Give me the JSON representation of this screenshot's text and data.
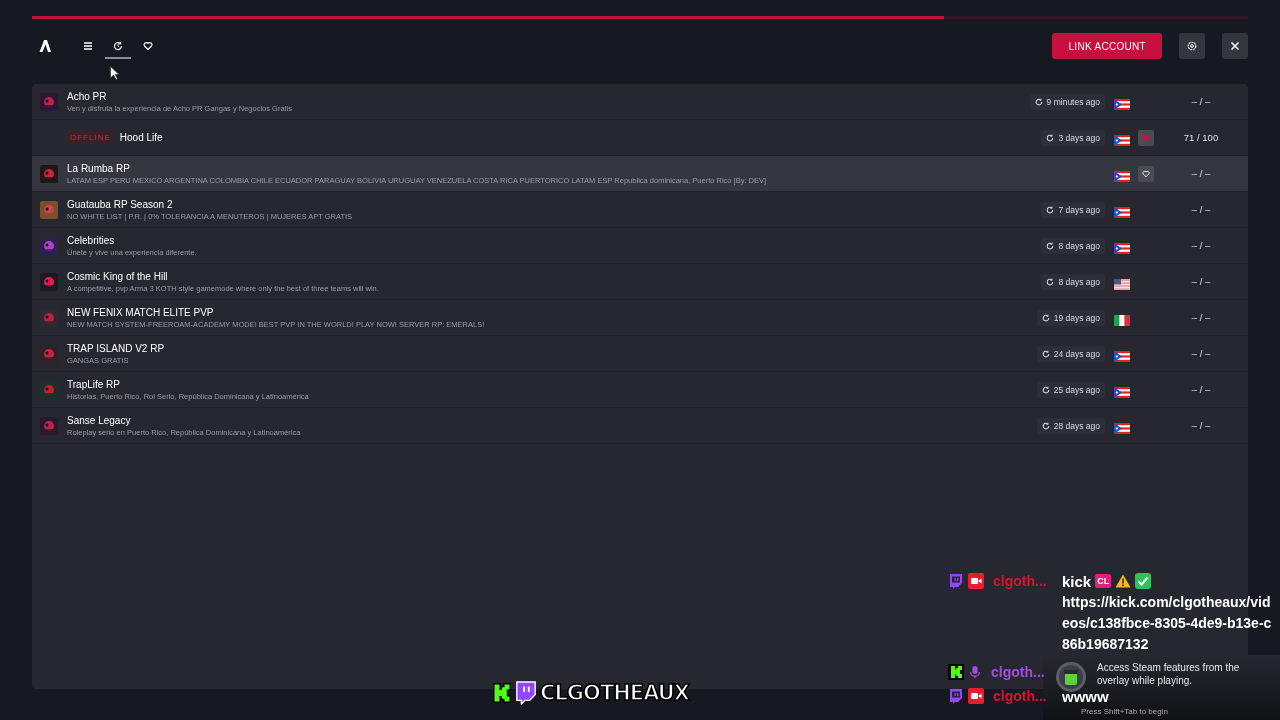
{
  "progress": {
    "level": 0.75
  },
  "nav_tabs": [
    {
      "kind": "menu",
      "selected": false
    },
    {
      "kind": "history",
      "selected": true
    },
    {
      "kind": "favorites",
      "selected": false
    }
  ],
  "link_account_button": "LINK ACCOUNT",
  "servers": [
    {
      "name": "Acho PR",
      "description": "Ven y disfruta la experiencia de Acho PR Gangas y Negocios Gratis",
      "offline": false,
      "hovered": false,
      "favorite": false,
      "last_seen": "9 minutes ago",
      "flag": {
        "kind": "pr"
      },
      "players": "– / –"
    },
    {
      "name": "Hood Life",
      "offline_label": "OFFLINE",
      "offline": true,
      "hovered": false,
      "favorite": true,
      "last_seen": "3 days ago",
      "flag": {
        "kind": "pr"
      },
      "players": "71 / 100"
    },
    {
      "name": "La Rumba RP",
      "description": "LATAM ESP PERU MEXICO ARGENTINA COLOMBIA CHILE ECUADOR PARAGUAY BOLIVIA URUGUAY VENEZUELA COSTA RICA PUERTORICO LATAM ESP Republica dominicana, Puerto Rico [By: DEV]",
      "offline": false,
      "hovered": true,
      "favorite": false,
      "flag": {
        "kind": "pr"
      },
      "players": "– / –"
    },
    {
      "name": "Guatauba RP Season 2",
      "description": "NO WHITE LIST  |  P.R.  |  0% TOLERANCIA A MENUTEROS  |  MUJERES APT GRATIS",
      "offline": false,
      "hovered": false,
      "favorite": false,
      "last_seen": "7 days ago",
      "flag": {
        "kind": "pr"
      },
      "players": "– / –"
    },
    {
      "name": "Celebrities",
      "description": "Únete y vive una experiencia diferente.",
      "offline": false,
      "hovered": false,
      "favorite": false,
      "last_seen": "8 days ago",
      "flag": {
        "kind": "pr"
      },
      "players": "– / –"
    },
    {
      "name": "Cosmic King of the Hill",
      "description": "A competitive, pvp Arma 3 KOTH style gamemode where only the best of three teams will win.",
      "offline": false,
      "hovered": false,
      "favorite": false,
      "last_seen": "8 days ago",
      "flag": {
        "kind": "us"
      },
      "players": "– / –"
    },
    {
      "name": "NEW FENIX MATCH ELITE PVP",
      "description": "NEW MATCH SYSTEM-FREEROAM-ACADEMY MODE! BEST PVP IN THE WORLD! PLAY NOW! SERVER RP: EMERALS!",
      "offline": false,
      "hovered": false,
      "favorite": false,
      "last_seen": "19 days ago",
      "flag": {
        "kind": "it"
      },
      "players": "– / –"
    },
    {
      "name": "TRAP ISLAND V2 RP",
      "description": "GANGAS GRATIS",
      "offline": false,
      "hovered": false,
      "favorite": false,
      "last_seen": "24 days ago",
      "flag": {
        "kind": "pr"
      },
      "players": "– / –"
    },
    {
      "name": "TrapLife RP",
      "description": "Historias, Puerto Rico, Rol Serio, República Dominicana y Latinoamérica",
      "offline": false,
      "hovered": false,
      "favorite": false,
      "last_seen": "25 days ago",
      "flag": {
        "kind": "pr"
      },
      "players": "– / –"
    },
    {
      "name": "Sanse Legacy",
      "description": "Roleplay serio en Puerto Rico, República Dominicana y Latinoamérica",
      "offline": false,
      "hovered": false,
      "favorite": false,
      "last_seen": "28 days ago",
      "flag": {
        "kind": "pr"
      },
      "players": "– / –"
    }
  ],
  "stream_chat": [
    {
      "kind": "twitch",
      "username": "clgoth...",
      "color": "#d9142b",
      "message": "kick",
      "emote": "CL",
      "link": "https://kick.com/clgotheaux/videos/c138fbce-8305-4de9-b13e-c86b19687132"
    },
    {
      "kind": "kick",
      "username": "clgoth...",
      "color": "#a44be0"
    },
    {
      "kind": "twitch",
      "username": "clgoth...",
      "color": "#d9142b",
      "message": "wwww"
    }
  ],
  "steam_notice": {
    "text": "Access Steam features from the overlay while playing.",
    "hint": "Press Shift+Tab to begin"
  },
  "stream_logo": "CLGOTHEAUX"
}
